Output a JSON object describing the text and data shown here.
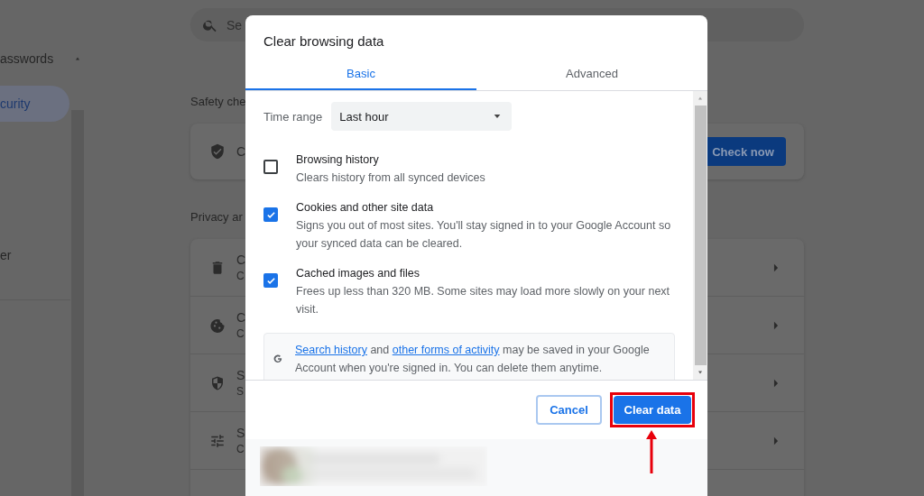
{
  "sidebar": {
    "items": [
      {
        "label": "asswords",
        "selected": false
      },
      {
        "label": "curity",
        "selected": true
      },
      {
        "label": "er",
        "selected": false
      }
    ]
  },
  "search": {
    "placeholder": "Se"
  },
  "safety_check": {
    "heading": "Safety che",
    "row_title": "C",
    "button": "Check now"
  },
  "privacy": {
    "heading": "Privacy ar",
    "rows": [
      {
        "title": "C",
        "subtitle": "C"
      },
      {
        "title": "C",
        "subtitle": "C"
      },
      {
        "title": "S",
        "subtitle": "S"
      },
      {
        "title": "S",
        "subtitle": "C"
      }
    ]
  },
  "dialog": {
    "title": "Clear browsing data",
    "tabs": [
      {
        "label": "Basic",
        "selected": true
      },
      {
        "label": "Advanced",
        "selected": false
      }
    ],
    "time_range": {
      "label": "Time range",
      "value": "Last hour"
    },
    "options": [
      {
        "title": "Browsing history",
        "description": "Clears history from all synced devices",
        "checked": false
      },
      {
        "title": "Cookies and other site data",
        "description": "Signs you out of most sites. You'll stay signed in to your Google Account so your synced data can be cleared.",
        "checked": true
      },
      {
        "title": "Cached images and files",
        "description": "Frees up less than 320 MB. Some sites may load more slowly on your next visit.",
        "checked": true
      }
    ],
    "notice": [
      {
        "kind": "link",
        "text": "Search history"
      },
      {
        "kind": "text",
        "text": " and "
      },
      {
        "kind": "link",
        "text": "other forms of activity"
      },
      {
        "kind": "text",
        "text": " may be saved in your Google Account when you're signed in. You can delete them anytime."
      }
    ],
    "buttons": [
      {
        "label": "Cancel",
        "kind": "secondary",
        "highlighted": false
      },
      {
        "label": "Clear data",
        "kind": "primary",
        "highlighted": true
      }
    ]
  },
  "annotation_arrow": true
}
